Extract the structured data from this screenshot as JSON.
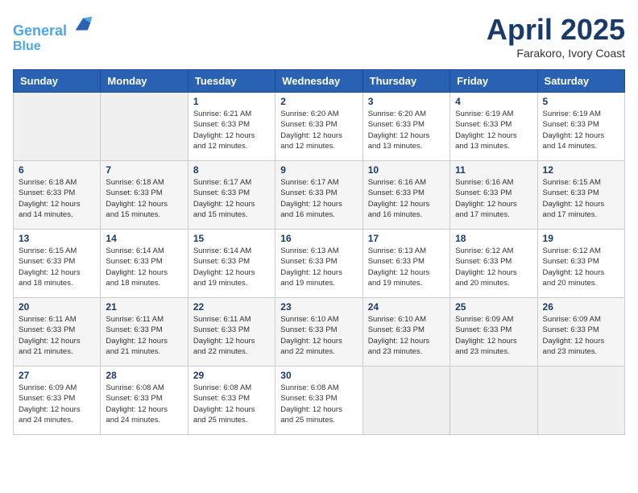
{
  "header": {
    "logo_line1": "General",
    "logo_line2": "Blue",
    "month": "April 2025",
    "location": "Farakoro, Ivory Coast"
  },
  "days_of_week": [
    "Sunday",
    "Monday",
    "Tuesday",
    "Wednesday",
    "Thursday",
    "Friday",
    "Saturday"
  ],
  "weeks": [
    [
      {
        "day": "",
        "info": ""
      },
      {
        "day": "",
        "info": ""
      },
      {
        "day": "1",
        "info": "Sunrise: 6:21 AM\nSunset: 6:33 PM\nDaylight: 12 hours\nand 12 minutes."
      },
      {
        "day": "2",
        "info": "Sunrise: 6:20 AM\nSunset: 6:33 PM\nDaylight: 12 hours\nand 12 minutes."
      },
      {
        "day": "3",
        "info": "Sunrise: 6:20 AM\nSunset: 6:33 PM\nDaylight: 12 hours\nand 13 minutes."
      },
      {
        "day": "4",
        "info": "Sunrise: 6:19 AM\nSunset: 6:33 PM\nDaylight: 12 hours\nand 13 minutes."
      },
      {
        "day": "5",
        "info": "Sunrise: 6:19 AM\nSunset: 6:33 PM\nDaylight: 12 hours\nand 14 minutes."
      }
    ],
    [
      {
        "day": "6",
        "info": "Sunrise: 6:18 AM\nSunset: 6:33 PM\nDaylight: 12 hours\nand 14 minutes."
      },
      {
        "day": "7",
        "info": "Sunrise: 6:18 AM\nSunset: 6:33 PM\nDaylight: 12 hours\nand 15 minutes."
      },
      {
        "day": "8",
        "info": "Sunrise: 6:17 AM\nSunset: 6:33 PM\nDaylight: 12 hours\nand 15 minutes."
      },
      {
        "day": "9",
        "info": "Sunrise: 6:17 AM\nSunset: 6:33 PM\nDaylight: 12 hours\nand 16 minutes."
      },
      {
        "day": "10",
        "info": "Sunrise: 6:16 AM\nSunset: 6:33 PM\nDaylight: 12 hours\nand 16 minutes."
      },
      {
        "day": "11",
        "info": "Sunrise: 6:16 AM\nSunset: 6:33 PM\nDaylight: 12 hours\nand 17 minutes."
      },
      {
        "day": "12",
        "info": "Sunrise: 6:15 AM\nSunset: 6:33 PM\nDaylight: 12 hours\nand 17 minutes."
      }
    ],
    [
      {
        "day": "13",
        "info": "Sunrise: 6:15 AM\nSunset: 6:33 PM\nDaylight: 12 hours\nand 18 minutes."
      },
      {
        "day": "14",
        "info": "Sunrise: 6:14 AM\nSunset: 6:33 PM\nDaylight: 12 hours\nand 18 minutes."
      },
      {
        "day": "15",
        "info": "Sunrise: 6:14 AM\nSunset: 6:33 PM\nDaylight: 12 hours\nand 19 minutes."
      },
      {
        "day": "16",
        "info": "Sunrise: 6:13 AM\nSunset: 6:33 PM\nDaylight: 12 hours\nand 19 minutes."
      },
      {
        "day": "17",
        "info": "Sunrise: 6:13 AM\nSunset: 6:33 PM\nDaylight: 12 hours\nand 19 minutes."
      },
      {
        "day": "18",
        "info": "Sunrise: 6:12 AM\nSunset: 6:33 PM\nDaylight: 12 hours\nand 20 minutes."
      },
      {
        "day": "19",
        "info": "Sunrise: 6:12 AM\nSunset: 6:33 PM\nDaylight: 12 hours\nand 20 minutes."
      }
    ],
    [
      {
        "day": "20",
        "info": "Sunrise: 6:11 AM\nSunset: 6:33 PM\nDaylight: 12 hours\nand 21 minutes."
      },
      {
        "day": "21",
        "info": "Sunrise: 6:11 AM\nSunset: 6:33 PM\nDaylight: 12 hours\nand 21 minutes."
      },
      {
        "day": "22",
        "info": "Sunrise: 6:11 AM\nSunset: 6:33 PM\nDaylight: 12 hours\nand 22 minutes."
      },
      {
        "day": "23",
        "info": "Sunrise: 6:10 AM\nSunset: 6:33 PM\nDaylight: 12 hours\nand 22 minutes."
      },
      {
        "day": "24",
        "info": "Sunrise: 6:10 AM\nSunset: 6:33 PM\nDaylight: 12 hours\nand 23 minutes."
      },
      {
        "day": "25",
        "info": "Sunrise: 6:09 AM\nSunset: 6:33 PM\nDaylight: 12 hours\nand 23 minutes."
      },
      {
        "day": "26",
        "info": "Sunrise: 6:09 AM\nSunset: 6:33 PM\nDaylight: 12 hours\nand 23 minutes."
      }
    ],
    [
      {
        "day": "27",
        "info": "Sunrise: 6:09 AM\nSunset: 6:33 PM\nDaylight: 12 hours\nand 24 minutes."
      },
      {
        "day": "28",
        "info": "Sunrise: 6:08 AM\nSunset: 6:33 PM\nDaylight: 12 hours\nand 24 minutes."
      },
      {
        "day": "29",
        "info": "Sunrise: 6:08 AM\nSunset: 6:33 PM\nDaylight: 12 hours\nand 25 minutes."
      },
      {
        "day": "30",
        "info": "Sunrise: 6:08 AM\nSunset: 6:33 PM\nDaylight: 12 hours\nand 25 minutes."
      },
      {
        "day": "",
        "info": ""
      },
      {
        "day": "",
        "info": ""
      },
      {
        "day": "",
        "info": ""
      }
    ]
  ]
}
